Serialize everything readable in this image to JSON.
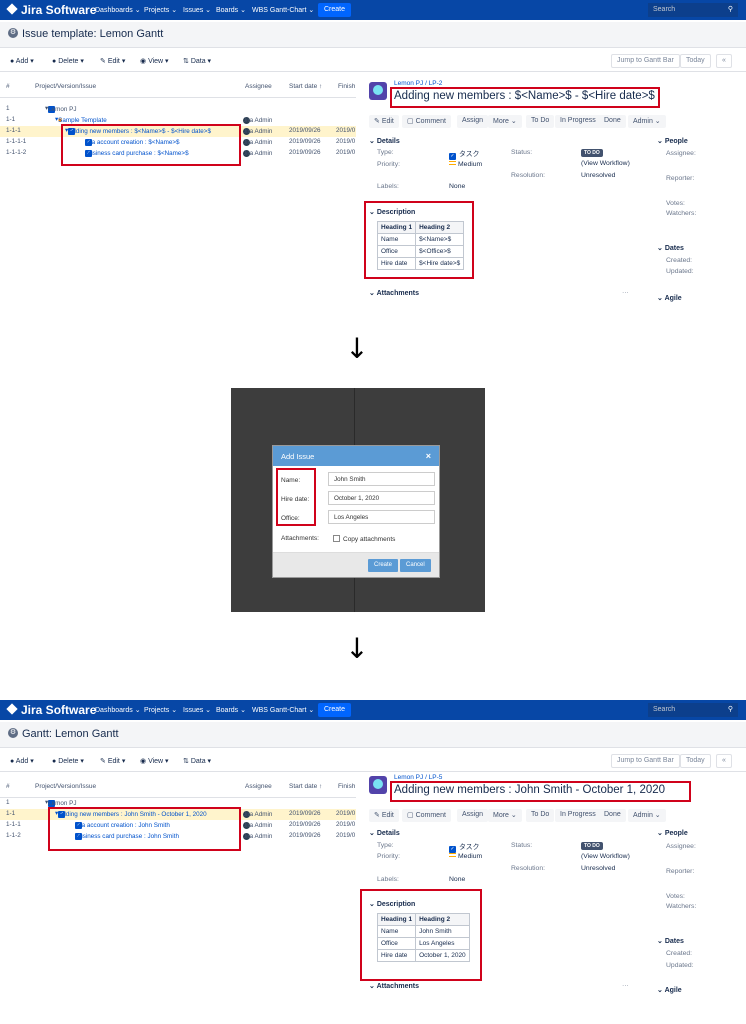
{
  "panel1": {
    "app": {
      "logo": "Jira Software",
      "nav": [
        "Dashboards ⌄",
        "Projects ⌄",
        "Issues ⌄",
        "Boards ⌄",
        "WBS Gantt-Chart ⌄"
      ],
      "create": "Create",
      "search_placeholder": "Search"
    },
    "page_title": "Issue template: Lemon Gantt",
    "toolbar": {
      "add": "Add ▾",
      "delete": "Delete ▾",
      "edit": "Edit ▾",
      "view": "View ▾",
      "data": "Data ▾",
      "jump": "Jump to Gantt Bar",
      "today": "Today",
      "collapse": "«"
    },
    "grid": {
      "headers": {
        "num": "#",
        "issue": "Project/Version/Issue",
        "assignee": "Assignee",
        "start": "Start date ↑",
        "finish": "Finish"
      },
      "rows": [
        {
          "num": "1",
          "issue": "Lemon PJ",
          "assignee": "",
          "start": "",
          "finish": ""
        },
        {
          "num": "1-1",
          "issue": "Sample Template",
          "assignee": "Jira Admin",
          "start": "",
          "finish": ""
        },
        {
          "num": "1-1-1",
          "issue": "Adding new members : $<Name>$ - $<Hire date>$",
          "assignee": "Jira Admin",
          "start": "2019/09/26",
          "finish": "2019/0"
        },
        {
          "num": "1-1-1-1",
          "issue": "Jira account creation : $<Name>$",
          "assignee": "Jira Admin",
          "start": "2019/09/26",
          "finish": "2019/0"
        },
        {
          "num": "1-1-1-2",
          "issue": "Business card purchase : $<Name>$",
          "assignee": "Jira Admin",
          "start": "2019/09/26",
          "finish": "2019/0"
        }
      ]
    },
    "detail": {
      "breadcrumb": "Lemon PJ /  LP-2",
      "summary": "Adding new members : $<Name>$ - $<Hire date>$",
      "actions": [
        "Edit",
        "Comment",
        "Assign",
        "More ⌄",
        "To Do",
        "In Progress",
        "Done",
        "Admin ⌄"
      ],
      "details_title": "Details",
      "type_label": "Type:",
      "type_value": "タスク",
      "priority_label": "Priority:",
      "priority_value": "Medium",
      "labels_label": "Labels:",
      "labels_value": "None",
      "status_label": "Status:",
      "status_value": "TO DO",
      "workflow": "(View Workflow)",
      "resolution_label": "Resolution:",
      "resolution_value": "Unresolved",
      "people_title": "People",
      "assignee_label": "Assignee:",
      "reporter_label": "Reporter:",
      "votes_label": "Votes:",
      "watchers_label": "Watchers:",
      "dates_title": "Dates",
      "created_label": "Created:",
      "updated_label": "Updated:",
      "agile_title": "Agile",
      "description_title": "Description",
      "table_headers": [
        "Heading 1",
        "Heading 2"
      ],
      "table_rows": [
        [
          "Name",
          "$<Name>$"
        ],
        [
          "Office",
          "$<Office>$"
        ],
        [
          "Hire date",
          "$<Hire date>$"
        ]
      ],
      "attachments_title": "Attachments",
      "more_dots": "···"
    }
  },
  "dialog": {
    "title": "Add Issue",
    "close": "×",
    "name_label": "Name:",
    "name_value": "John Smith",
    "hire_label": "Hire date:",
    "hire_value": "October 1, 2020",
    "office_label": "Office:",
    "office_value": "Los Angeles",
    "attachments_label": "Attachments:",
    "copy_label": "Copy attachments",
    "create": "Create",
    "cancel": "Cancel"
  },
  "panel2": {
    "page_title": "Gantt: Lemon Gantt",
    "grid": {
      "rows": [
        {
          "num": "1",
          "issue": "Lemon PJ",
          "assignee": "",
          "start": "",
          "finish": ""
        },
        {
          "num": "1-1",
          "issue": "Adding new members : John Smith - October 1, 2020",
          "assignee": "Jira Admin",
          "start": "2019/09/26",
          "finish": "2019/0"
        },
        {
          "num": "1-1-1",
          "issue": "Jira account creation : John Smith",
          "assignee": "Jira Admin",
          "start": "2019/09/26",
          "finish": "2019/0"
        },
        {
          "num": "1-1-2",
          "issue": "Business card purchase : John Smith",
          "assignee": "Jira Admin",
          "start": "2019/09/26",
          "finish": "2019/0"
        }
      ]
    },
    "detail": {
      "breadcrumb": "Lemon PJ /  LP-5",
      "summary": "Adding new members : John Smith - October 1, 2020",
      "table_rows": [
        [
          "Name",
          "John Smith"
        ],
        [
          "Office",
          "Los Angeles"
        ],
        [
          "Hire date",
          "October 1, 2020"
        ]
      ]
    }
  },
  "arrows": [
    "↓",
    "↓"
  ]
}
